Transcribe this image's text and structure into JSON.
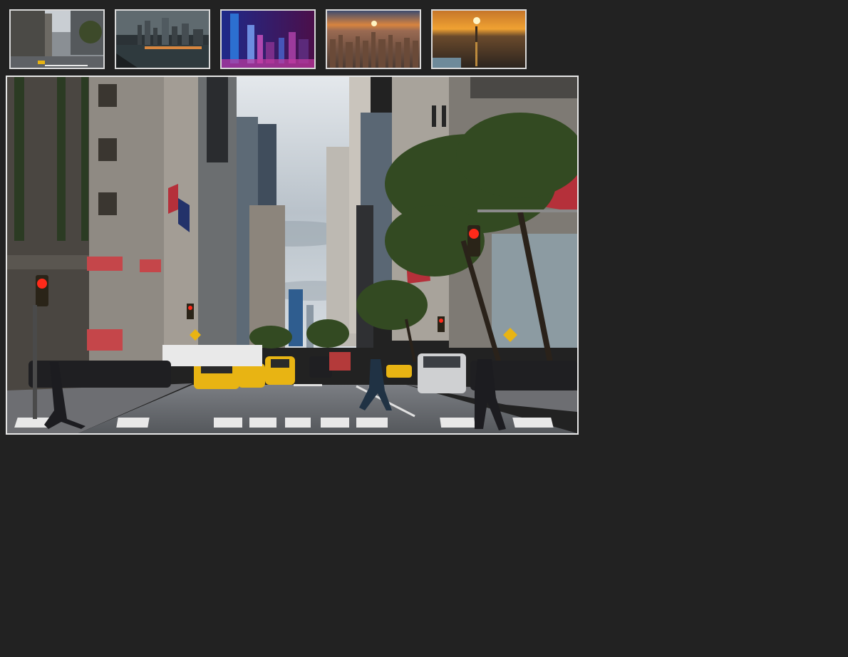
{
  "gallery": {
    "thumbnails": [
      {
        "subject": "street-avenue-daytime",
        "selected": true
      },
      {
        "subject": "harbor-skyline-dusk",
        "selected": false
      },
      {
        "subject": "night-skyline-purple",
        "selected": false
      },
      {
        "subject": "aerial-skyline-sunset",
        "selected": false
      },
      {
        "subject": "aerial-skyline-golden-hour",
        "selected": false
      }
    ],
    "main": {
      "subject": "street-avenue-daytime"
    }
  },
  "colors": {
    "page_background": "#222222",
    "thumb_border": "#d9d9d9",
    "main_border": "#e6e6e6",
    "taxi_yellow": "#e8b413",
    "signal_red": "#ff2a1a"
  }
}
